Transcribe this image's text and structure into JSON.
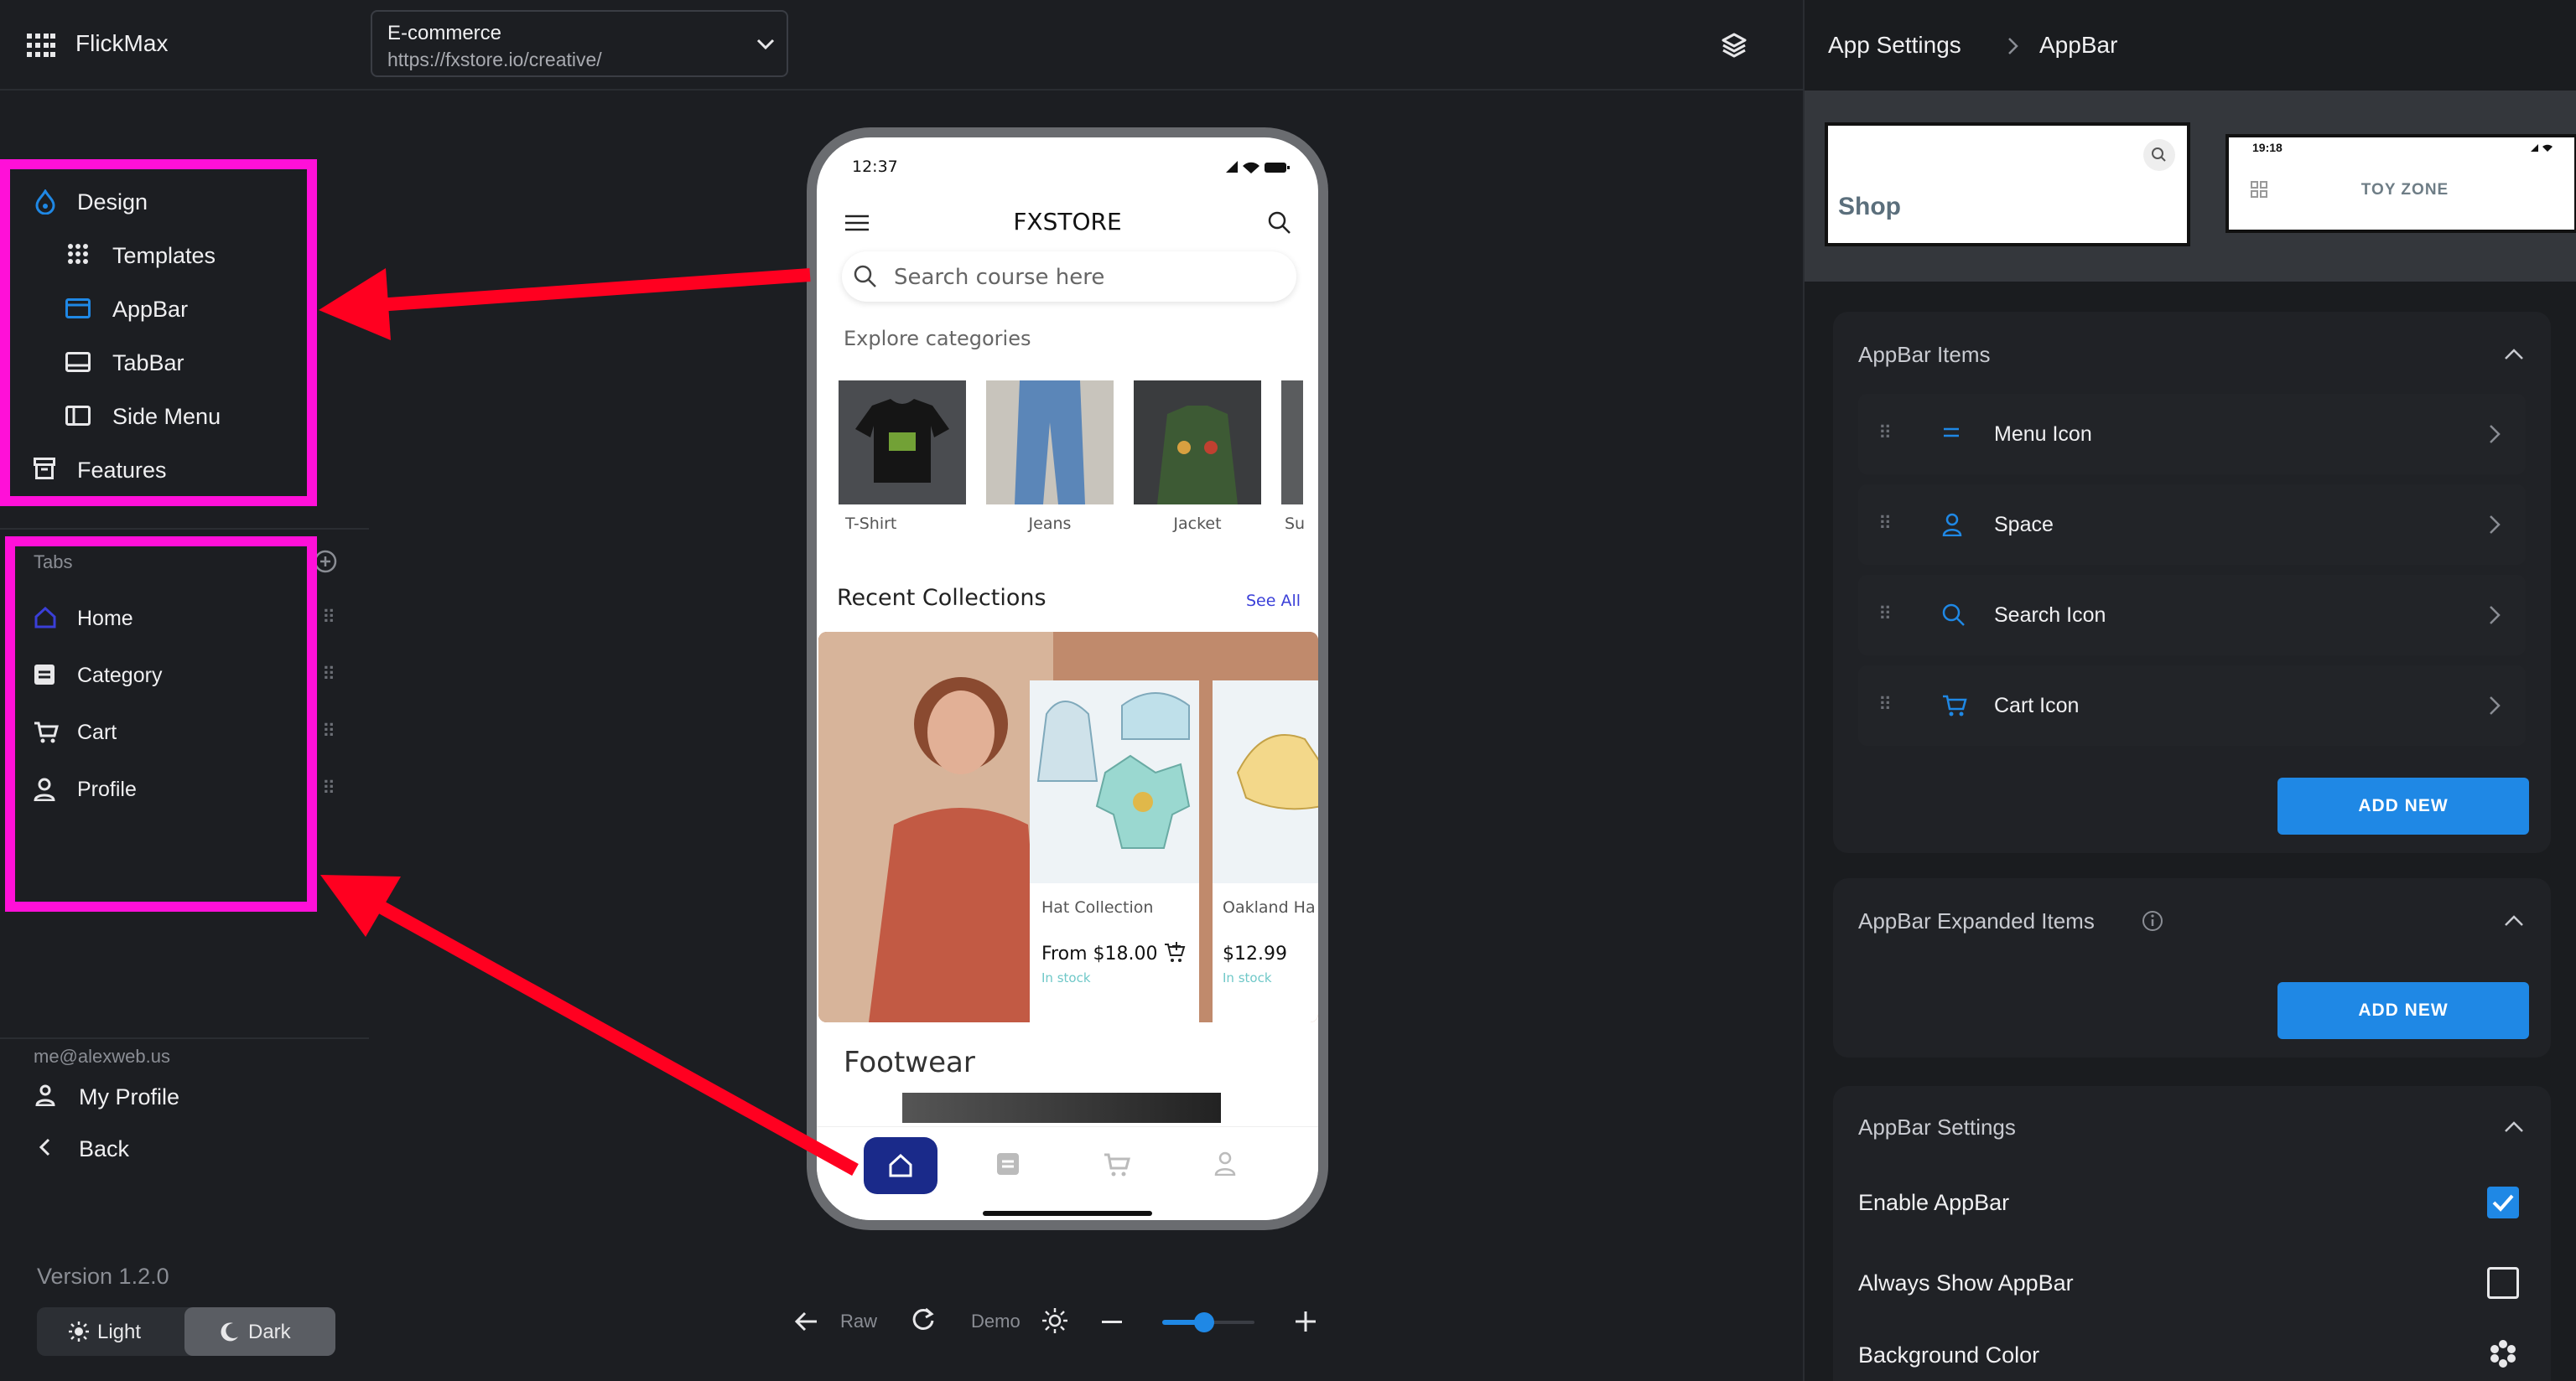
{
  "app": {
    "name": "FlickMax"
  },
  "project": {
    "name": "E-commerce",
    "url": "https://fxstore.io/creative/"
  },
  "design_menu": {
    "header": "Design",
    "items": [
      {
        "label": "Templates",
        "icon": "grid-dots-icon"
      },
      {
        "label": "AppBar",
        "icon": "appbar-icon"
      },
      {
        "label": "TabBar",
        "icon": "tabbar-icon"
      },
      {
        "label": "Side Menu",
        "icon": "side-menu-icon"
      }
    ],
    "features": "Features"
  },
  "tabs": {
    "header": "Tabs",
    "items": [
      {
        "label": "Home",
        "icon": "home-icon"
      },
      {
        "label": "Category",
        "icon": "category-icon"
      },
      {
        "label": "Cart",
        "icon": "cart-icon"
      },
      {
        "label": "Profile",
        "icon": "profile-icon"
      }
    ]
  },
  "account": {
    "email": "me@alexweb.us",
    "my_profile": "My Profile",
    "back": "Back"
  },
  "version": "Version 1.2.0",
  "theme": {
    "light": "Light",
    "dark": "Dark",
    "selected": "Dark"
  },
  "phone": {
    "time": "12:37",
    "title": "FXSTORE",
    "search_placeholder": "Search course here",
    "explore": "Explore categories",
    "categories": [
      "T-Shirt",
      "Jeans",
      "Jacket",
      "Su"
    ],
    "recent": "Recent Collections",
    "see_all": "See All",
    "products": [
      {
        "name": "Hat Collection",
        "price": "From $18.00",
        "stock": "In stock"
      },
      {
        "name": "Oakland Ha",
        "price": "$12.99",
        "stock": "In stock"
      }
    ],
    "footwear": "Footwear"
  },
  "toolbar": {
    "raw": "Raw",
    "demo": "Demo",
    "zoom_level": 0.45
  },
  "settings": {
    "breadcrumb": [
      "App Settings",
      "AppBar"
    ],
    "previews": [
      {
        "label": "Shop"
      },
      {
        "time": "19:18",
        "label": "TOY ZONE"
      }
    ],
    "appbar_items": {
      "title": "AppBar Items",
      "items": [
        {
          "label": "Menu Icon",
          "icon": "menu-icon"
        },
        {
          "label": "Space",
          "icon": "person-icon"
        },
        {
          "label": "Search Icon",
          "icon": "search-icon"
        },
        {
          "label": "Cart Icon",
          "icon": "cart-icon"
        }
      ],
      "add_new": "ADD NEW"
    },
    "expanded": {
      "title": "AppBar Expanded Items",
      "add_new": "ADD NEW"
    },
    "appbar_settings": {
      "title": "AppBar Settings",
      "enable": {
        "label": "Enable AppBar",
        "checked": true
      },
      "always_show": {
        "label": "Always Show AppBar",
        "checked": false
      },
      "bg_color": {
        "label": "Background Color"
      }
    }
  },
  "colors": {
    "accent": "#1f88e5",
    "highlight": "#ff10d8",
    "arrow": "#ff0020",
    "phone_nav": "#1a2a8a"
  }
}
